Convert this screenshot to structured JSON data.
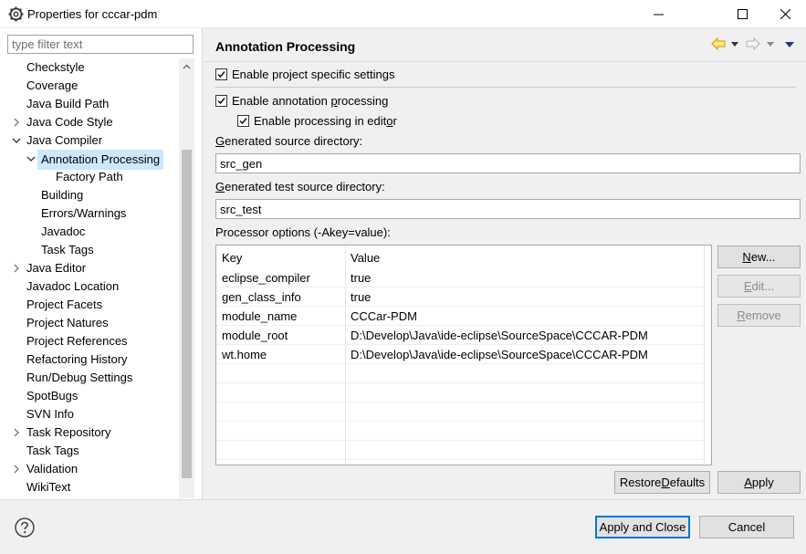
{
  "window": {
    "title": "Properties for cccar-pdm"
  },
  "filter": {
    "placeholder": "type filter text"
  },
  "tree": [
    {
      "label": "Checkstyle",
      "indent": 0,
      "chevron": "none"
    },
    {
      "label": "Coverage",
      "indent": 0,
      "chevron": "none"
    },
    {
      "label": "Java Build Path",
      "indent": 0,
      "chevron": "none"
    },
    {
      "label": "Java Code Style",
      "indent": 0,
      "chevron": "right"
    },
    {
      "label": "Java Compiler",
      "indent": 0,
      "chevron": "down"
    },
    {
      "label": "Annotation Processing",
      "indent": 1,
      "chevron": "down",
      "selected": true
    },
    {
      "label": "Factory Path",
      "indent": 2,
      "chevron": "none"
    },
    {
      "label": "Building",
      "indent": 1,
      "chevron": "none"
    },
    {
      "label": "Errors/Warnings",
      "indent": 1,
      "chevron": "none"
    },
    {
      "label": "Javadoc",
      "indent": 1,
      "chevron": "none"
    },
    {
      "label": "Task Tags",
      "indent": 1,
      "chevron": "none"
    },
    {
      "label": "Java Editor",
      "indent": 0,
      "chevron": "right"
    },
    {
      "label": "Javadoc Location",
      "indent": 0,
      "chevron": "none"
    },
    {
      "label": "Project Facets",
      "indent": 0,
      "chevron": "none"
    },
    {
      "label": "Project Natures",
      "indent": 0,
      "chevron": "none"
    },
    {
      "label": "Project References",
      "indent": 0,
      "chevron": "none"
    },
    {
      "label": "Refactoring History",
      "indent": 0,
      "chevron": "none"
    },
    {
      "label": "Run/Debug Settings",
      "indent": 0,
      "chevron": "none"
    },
    {
      "label": "SpotBugs",
      "indent": 0,
      "chevron": "none"
    },
    {
      "label": "SVN Info",
      "indent": 0,
      "chevron": "none"
    },
    {
      "label": "Task Repository",
      "indent": 0,
      "chevron": "right"
    },
    {
      "label": "Task Tags",
      "indent": 0,
      "chevron": "none"
    },
    {
      "label": "Validation",
      "indent": 0,
      "chevron": "right"
    },
    {
      "label": "WikiText",
      "indent": 0,
      "chevron": "none"
    }
  ],
  "page": {
    "title": "Annotation Processing",
    "enable_project_specific": {
      "pre": "Enable pro",
      "u": "j",
      "post": "ect specific settings",
      "checked": true
    },
    "enable_annotation": {
      "pre": "Enable annotation ",
      "u": "p",
      "post": "rocessing",
      "checked": true
    },
    "enable_in_editor": {
      "pre": "Enable processing in edit",
      "u": "o",
      "post": "r",
      "checked": true
    },
    "gen_source_label": {
      "u": "G",
      "post": "enerated source directory:"
    },
    "gen_source_value": "src_gen",
    "gen_test_label": {
      "u": "G",
      "post": "enerated test source directory:"
    },
    "gen_test_value": "src_test",
    "processor_label": "Processor options (-Akey=value):",
    "table": {
      "headers": [
        "Key",
        "Value"
      ],
      "rows": [
        [
          "eclipse_compiler",
          "true"
        ],
        [
          "gen_class_info",
          "true"
        ],
        [
          "module_name",
          "CCCar-PDM"
        ],
        [
          "module_root",
          "D:\\Develop\\Java\\ide-eclipse\\SourceSpace\\CCCAR-PDM"
        ],
        [
          "wt.home",
          "D:\\Develop\\Java\\ide-eclipse\\SourceSpace\\CCCAR-PDM"
        ]
      ],
      "empty_rows": 5
    },
    "buttons": {
      "new": {
        "u": "N",
        "post": "ew..."
      },
      "edit": {
        "u": "E",
        "post": "dit..."
      },
      "remove": {
        "u": "R",
        "post": "emove"
      },
      "restore": {
        "pre": "Restore ",
        "u": "D",
        "post": "efaults"
      },
      "apply": {
        "u": "A",
        "post": "pply"
      }
    }
  },
  "bottom": {
    "apply_close": "Apply and Close",
    "cancel": "Cancel"
  },
  "colors": {
    "selection": "#cce8ff",
    "default_button_border": "#0078d7",
    "nav_arrow": "#e8b400"
  }
}
